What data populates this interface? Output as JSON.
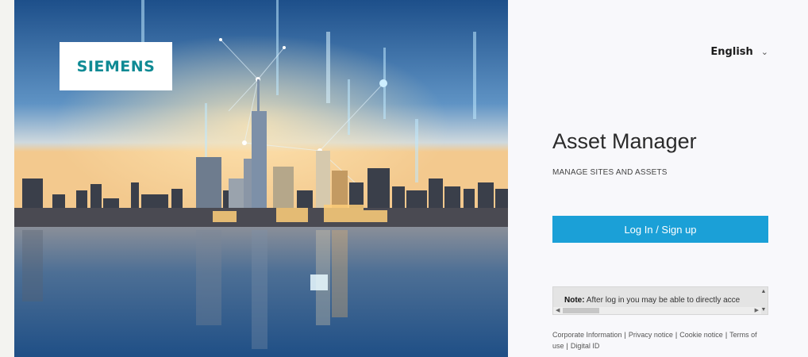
{
  "hero": {
    "logo_text": "SIEMENS"
  },
  "panel": {
    "language": "English",
    "title": "Asset Manager",
    "subtitle": "MANAGE SITES AND ASSETS",
    "login_button": "Log In / Sign up",
    "note_label": "Note:",
    "note_text": "After log in you may be able to directly acce",
    "footer_links": [
      "Corporate Information",
      "Privacy notice",
      "Cookie notice",
      "Terms of use",
      "Digital ID"
    ]
  },
  "colors": {
    "brand_teal": "#0f8a94",
    "button_blue": "#1ba0d7"
  }
}
